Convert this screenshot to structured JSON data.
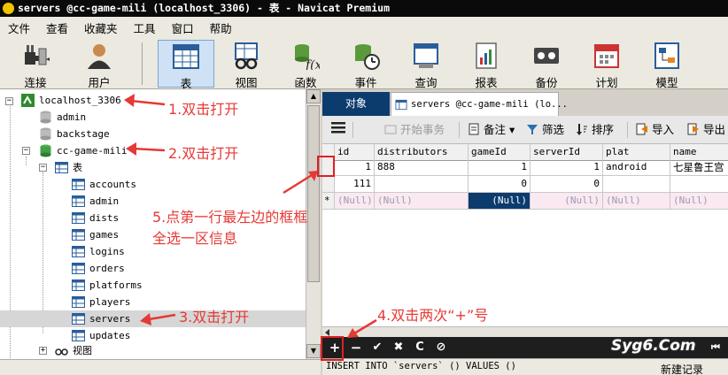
{
  "window": {
    "title": "servers @cc-game-mili (localhost_3306) - 表 - Navicat Premium"
  },
  "menu": [
    "文件",
    "查看",
    "收藏夹",
    "工具",
    "窗口",
    "帮助"
  ],
  "toolbar": {
    "connect": "连接",
    "user": "用户",
    "table": "表",
    "view": "视图",
    "function": "函数",
    "event": "事件",
    "query": "查询",
    "report": "报表",
    "backup": "备份",
    "schedule": "计划",
    "model": "模型"
  },
  "tree": {
    "connection": "localhost_3306",
    "databases": [
      "admin",
      "backstage"
    ],
    "active_db": "cc-game-mili",
    "tables_folder": "表",
    "tables": [
      "accounts",
      "admin",
      "dists",
      "games",
      "logins",
      "orders",
      "platforms",
      "players",
      "servers",
      "updates"
    ],
    "selected_table": "servers",
    "views_folder": "视图"
  },
  "tabs": {
    "objects": "对象",
    "servers": "servers @cc-game-mili (lo..."
  },
  "grid_toolbar": {
    "begin_tx": "开始事务",
    "note": "备注",
    "filter": "筛选",
    "sort": "排序",
    "import": "导入",
    "export": "导出"
  },
  "grid": {
    "columns": [
      "id",
      "distributors",
      "gameId",
      "serverId",
      "plat",
      "name"
    ],
    "rows": [
      [
        "1",
        "888",
        "1",
        "1",
        "android",
        "七星鲁王宫"
      ],
      [
        "111",
        "",
        "0",
        "0",
        "",
        ""
      ],
      [
        "(Null)",
        "(Null)",
        "(Null)",
        "(Null)",
        "(Null)",
        "(Null)"
      ]
    ],
    "new_row_marker": "*"
  },
  "navbar": {
    "add": "+",
    "remove": "−",
    "commit": "✔",
    "discard": "✖",
    "refresh": "C",
    "stop": "⊘"
  },
  "statusbar": {
    "sql": "INSERT INTO `servers` () VALUES ()",
    "new_record": "新建记录"
  },
  "annotations": {
    "a1": "1.双击打开",
    "a2": "2.双击打开",
    "a3": "3.双击打开",
    "a4": "4.双击两次“+”号",
    "a5_line1": "5.点第一行最左边的框框",
    "a5_line2": "全选一区信息"
  },
  "watermark": "Syg6.Com",
  "colors": {
    "title_bg": "#0a0a0a",
    "accent_blue": "#0c3b6e",
    "annotation_red": "#e53935",
    "new_row_pink": "#fbe9f1"
  }
}
